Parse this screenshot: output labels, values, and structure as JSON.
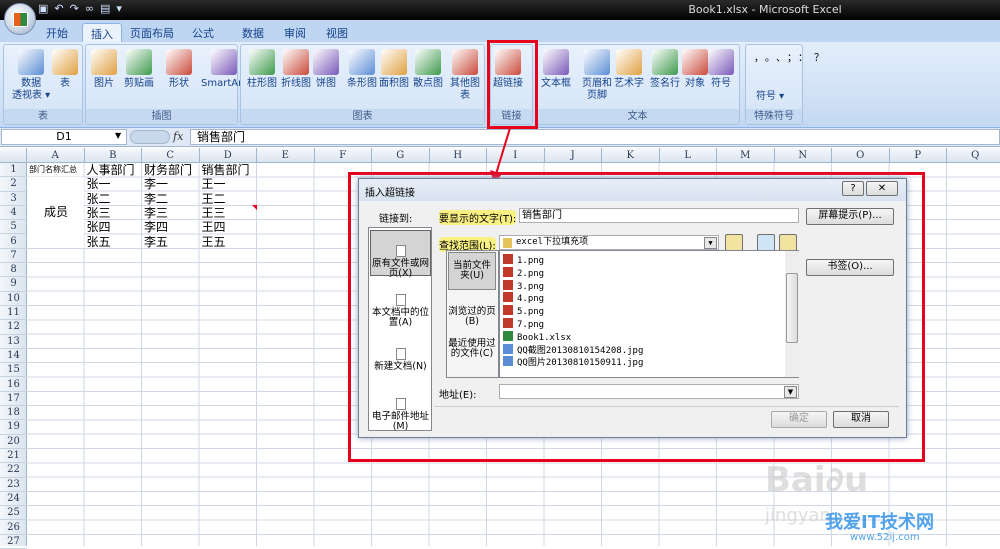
{
  "window": {
    "title": "Book1.xlsx - Microsoft Excel"
  },
  "qat": {
    "icons": [
      "save-icon",
      "undo-icon",
      "redo-icon",
      "hyperlink-icon",
      "form-icon"
    ]
  },
  "tabs": [
    {
      "label": "开始"
    },
    {
      "label": "插入"
    },
    {
      "label": "页面布局"
    },
    {
      "label": "公式"
    },
    {
      "label": "数据"
    },
    {
      "label": "审阅"
    },
    {
      "label": "视图"
    }
  ],
  "ribbon": {
    "groups": [
      {
        "label": "表",
        "buttons": [
          {
            "label": "数据",
            "label2": "透视表 ▾",
            "icon": "pivot-table-icon"
          },
          {
            "label": "表",
            "icon": "table-icon"
          }
        ]
      },
      {
        "label": "插图",
        "buttons": [
          {
            "label": "图片",
            "icon": "picture-icon"
          },
          {
            "label": "剪贴画",
            "icon": "clipart-icon"
          },
          {
            "label": "形状",
            "icon": "shapes-icon"
          },
          {
            "label": "SmartArt",
            "icon": "smartart-icon"
          }
        ]
      },
      {
        "label": "图表",
        "buttons": [
          {
            "label": "柱形图",
            "icon": "column-chart-icon"
          },
          {
            "label": "折线图",
            "icon": "line-chart-icon"
          },
          {
            "label": "饼图",
            "icon": "pie-chart-icon"
          },
          {
            "label": "条形图",
            "icon": "bar-chart-icon"
          },
          {
            "label": "面积图",
            "icon": "area-chart-icon"
          },
          {
            "label": "散点图",
            "icon": "scatter-chart-icon"
          },
          {
            "label": "其他图表",
            "icon": "other-charts-icon"
          }
        ]
      },
      {
        "label": "链接",
        "buttons": [
          {
            "label": "超链接",
            "icon": "hyperlink-globe-icon"
          }
        ]
      },
      {
        "label": "文本",
        "buttons": [
          {
            "label": "文本框",
            "icon": "textbox-icon"
          },
          {
            "label": "页眉和",
            "label2": "页脚",
            "icon": "header-footer-icon"
          },
          {
            "label": "艺术字",
            "icon": "wordart-icon"
          },
          {
            "label": "签名行",
            "icon": "signature-icon"
          },
          {
            "label": "对象",
            "icon": "object-icon"
          },
          {
            "label": "符号",
            "icon": "omega-icon"
          }
        ]
      },
      {
        "label": "特殊符号",
        "symbols": "，。、；：？",
        "button": "符号 ▾"
      }
    ]
  },
  "formula_bar": {
    "name_box": "D1",
    "fx": "fx",
    "content": "销售部门"
  },
  "sheet": {
    "columns": [
      "A",
      "B",
      "C",
      "D",
      "E",
      "F",
      "G",
      "H",
      "I",
      "J",
      "K",
      "L",
      "M",
      "N",
      "O",
      "P",
      "Q"
    ],
    "rows": [
      "1",
      "2",
      "3",
      "4",
      "5",
      "6",
      "7",
      "8",
      "9",
      "10",
      "11",
      "12",
      "13",
      "14",
      "15",
      "16",
      "17",
      "18",
      "19",
      "20",
      "21",
      "22",
      "23",
      "24",
      "25",
      "26",
      "27"
    ],
    "cells": {
      "A1": "部门名称汇总",
      "B1": "人事部门",
      "C1": "财务部门",
      "D1": "销售部门",
      "A2_6": "成员",
      "B2": "张一",
      "B3": "张二",
      "B4": "张三",
      "B5": "张四",
      "B6": "张五",
      "C2": "李一",
      "C3": "李二",
      "C4": "李三",
      "C5": "李四",
      "C6": "李五",
      "D2": "王一",
      "D3": "王二",
      "D4": "王三",
      "D5": "王四",
      "D6": "王五"
    }
  },
  "dialog": {
    "title": "插入超链接",
    "help": "?",
    "close": "✕",
    "link_to_label": "链接到:",
    "link_to": [
      {
        "label": "原有文件或网页(X)"
      },
      {
        "label": "本文档中的位置(A)"
      },
      {
        "label": "新建文档(N)"
      },
      {
        "label": "电子邮件地址(M)"
      }
    ],
    "display_text_label": "要显示的文字(T):",
    "display_text": "销售部门",
    "screen_tip": "屏幕提示(P)...",
    "look_in_label": "查找范围(L):",
    "look_in": "excel下拉填充项",
    "nav": [
      {
        "label": "当前文件夹(U)"
      },
      {
        "label": "浏览过的页(B)"
      },
      {
        "label": "最近使用过的文件(C)"
      }
    ],
    "files": [
      {
        "name": "1.png",
        "type": "png"
      },
      {
        "name": "2.png",
        "type": "png"
      },
      {
        "name": "3.png",
        "type": "png"
      },
      {
        "name": "4.png",
        "type": "png"
      },
      {
        "name": "5.png",
        "type": "png"
      },
      {
        "name": "7.png",
        "type": "png"
      },
      {
        "name": "Book1.xlsx",
        "type": "xlsx"
      },
      {
        "name": "QQ截图20130810154208.jpg",
        "type": "jpg"
      },
      {
        "name": "QQ图片20130810150911.jpg",
        "type": "jpg"
      }
    ],
    "bookmark": "书签(O)...",
    "address_label": "地址(E):",
    "address": "",
    "ok": "确定",
    "cancel": "取消"
  },
  "watermark": {
    "baidu": "Baidu经验",
    "site": "jingyan.baidu.com",
    "brand": "我爱IT技术网",
    "url": "www.52ij.com"
  },
  "colors": {
    "highlight": "#e8001c",
    "ribbon": "#cfe0f5",
    "tab_bar": "#bfd6f2"
  }
}
